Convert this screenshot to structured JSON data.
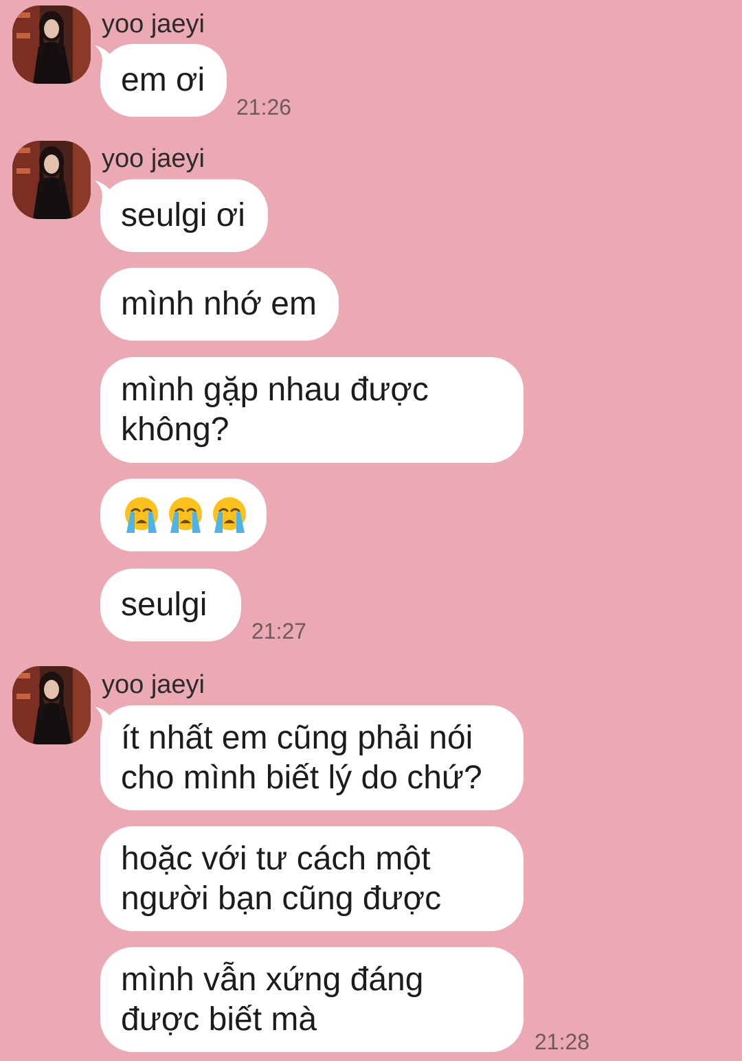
{
  "chat": {
    "sender_name": "yoo jaeyi",
    "groups": [
      {
        "time": "21:26",
        "messages": [
          "em ơi"
        ]
      },
      {
        "time": "21:27",
        "messages": [
          "seulgi ơi",
          "mình nhớ em",
          "mình gặp nhau được không?",
          "😭😭😭",
          "seulgi"
        ]
      },
      {
        "time": "21:28",
        "messages": [
          "ít nhất em cũng phải nói cho mình biết lý do chứ?",
          "hoặc với tư cách một người bạn cũng được",
          "mình vẫn xứng đáng được biết mà"
        ]
      }
    ]
  },
  "icons": {
    "avatar": "profile-photo",
    "crying_emoji": "loudly-crying-face-icon"
  },
  "colors": {
    "background": "#eba9b3",
    "bubble": "#ffffff",
    "text": "#1c1c1c",
    "timestamp": "#6e5a5e"
  }
}
